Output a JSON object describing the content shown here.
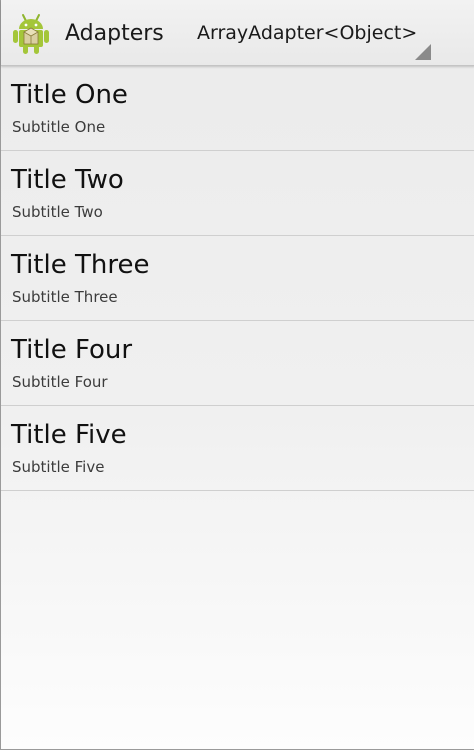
{
  "action_bar": {
    "app_icon": "android-robot-icon",
    "title": "Adapters",
    "spinner": {
      "selected": "ArrayAdapter<Object>",
      "arrow_icon": "spinner-corner-arrow-icon"
    }
  },
  "list": {
    "items": [
      {
        "title": "Title One",
        "subtitle": "Subtitle One"
      },
      {
        "title": "Title Two",
        "subtitle": "Subtitle Two"
      },
      {
        "title": "Title Three",
        "subtitle": "Subtitle Three"
      },
      {
        "title": "Title Four",
        "subtitle": "Subtitle Four"
      },
      {
        "title": "Title Five",
        "subtitle": "Subtitle Five"
      }
    ]
  },
  "colors": {
    "android_green": "#a4c639",
    "action_bar_bg": "#eeeeee",
    "text_primary": "#111111",
    "text_secondary": "#3c3c3c",
    "divider": "#cfcfcf"
  }
}
